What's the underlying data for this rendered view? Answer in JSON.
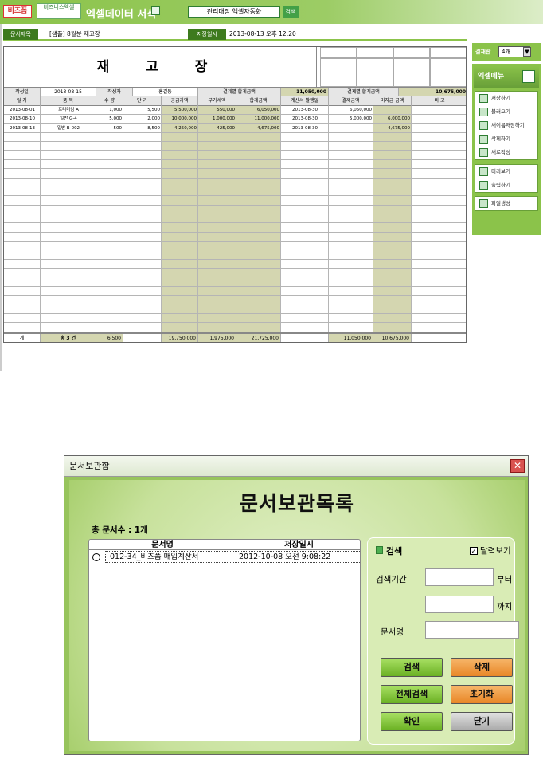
{
  "app": {
    "brand_logo": "비즈폼",
    "brand_logo2": "비즈니스엑셀",
    "title": "엑셀데이터 서식",
    "search_box_value": "관리대장 엑셀자동화",
    "search_button": "검색"
  },
  "doc_info": {
    "title_label": "문서제목",
    "title_value": "[샘플] 8월분 재고장",
    "saved_label": "저장일시",
    "saved_value": "2013-08-13 오후 12:20"
  },
  "sheet": {
    "main_title": "재 고 장",
    "summary": {
      "author_date_label": "작성일",
      "author_date": "2013-08-15",
      "author_label": "작성자",
      "author": "홍길동",
      "payment_total_label": "결제별 합계금액",
      "payment_total": "11,050,000",
      "unpaid_total_label": "결제별 합계금액",
      "unpaid_total": "10,675,000"
    },
    "headers": [
      "일 자",
      "품 목",
      "수 량",
      "단 가",
      "공급가액",
      "부가세액",
      "합계금액",
      "계산서 발행일",
      "결제금액",
      "미지급 금액",
      "비 고"
    ],
    "rows": [
      [
        "2013-08-01",
        "프리미엄 A",
        "1,000",
        "5,500",
        "5,500,000",
        "550,000",
        "6,050,000",
        "2013-08-30",
        "6,050,000",
        "",
        ""
      ],
      [
        "2013-08-10",
        "일반 G-4",
        "5,000",
        "2,000",
        "10,000,000",
        "1,000,000",
        "11,000,000",
        "2013-08-30",
        "5,000,000",
        "6,000,000",
        ""
      ],
      [
        "2013-08-13",
        "일반 B-002",
        "500",
        "8,500",
        "4,250,000",
        "425,000",
        "4,675,000",
        "2013-08-30",
        "",
        "4,675,000",
        ""
      ]
    ],
    "totals": {
      "label": "계",
      "count": "총 3 건",
      "qty": "6,500",
      "supply": "19,750,000",
      "vat": "1,975,000",
      "sum": "21,725,000",
      "paid": "11,050,000",
      "unpaid": "10,675,000"
    }
  },
  "side": {
    "approval_label": "결재란",
    "approval_value": "4개",
    "menu_title": "엑셀메뉴",
    "menu_items_1": [
      "저장하기",
      "불러오기",
      "새이름저장하기",
      "삭제하기",
      "새로작성"
    ],
    "menu_items_2": [
      "미리보기",
      "출력하기"
    ],
    "menu_items_3": [
      "파일생성"
    ]
  },
  "dialog": {
    "window_title": "문서보관함",
    "heading": "문서보관목록",
    "doc_count": "총 문서수 : 1개",
    "col_name": "문서명",
    "col_saved": "저장일시",
    "docs": [
      {
        "name": "012-34_비즈폼 매입계산서",
        "saved": "2012-10-08 오전 9:08:22"
      }
    ],
    "search_title": "검색",
    "calendar_label": "달력보기",
    "period_label": "검색기간",
    "from_label": "부터",
    "to_label": "까지",
    "docname_label": "문서명",
    "btn_search": "검색",
    "btn_delete": "삭제",
    "btn_search_all": "전체검색",
    "btn_reset": "초기화",
    "btn_ok": "확인",
    "btn_close": "닫기",
    "close_glyph": "✕"
  }
}
